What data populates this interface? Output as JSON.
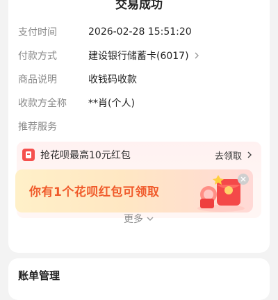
{
  "header": {
    "title": "交易成功"
  },
  "details": {
    "pay_time_label": "支付时间",
    "pay_time_value": "2026-02-28 15:51:20",
    "pay_method_label": "付款方式",
    "pay_method_value": "建设银行储蓄卡(6017)",
    "goods_label": "商品说明",
    "goods_value": "收钱码收款",
    "payee_label": "收款方全称",
    "payee_value": "**肖(个人)",
    "recommend_label": "推荐服务"
  },
  "promo": {
    "title": "抢花呗最高10元红包",
    "link": "去领取",
    "banner_text": "你有1个花呗红包可领取"
  },
  "more_label": "更多",
  "bill": {
    "title": "账单管理"
  },
  "colors": {
    "accent_red": "#f5504d",
    "banner_text": "#f05a2a"
  },
  "icons": {
    "chevron": "chevron-right-icon",
    "coupon": "coupon-icon",
    "close": "close-icon",
    "more": "chevron-down-icon"
  }
}
